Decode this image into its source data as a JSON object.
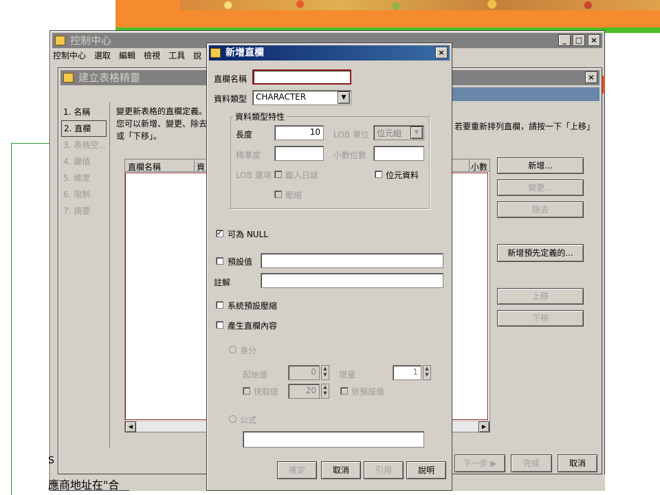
{
  "control_center": {
    "title": "控制中心",
    "menu": [
      "控制中心",
      "選取",
      "編輯",
      "檢視",
      "工具",
      "說"
    ],
    "minimize": "_",
    "maximize": "□",
    "close": "×"
  },
  "wizard": {
    "title": "建立表格精靈",
    "close": "×",
    "steps": [
      "1. 名稱",
      "2. 直欄",
      "3. 表格空...",
      "4. 鍵值",
      "5. 維度",
      "6. 限制",
      "7. 摘要"
    ],
    "description_line1": "變更新表格的直欄定義。",
    "description_line2": "您可以新增、變更、除去",
    "description_line3": "或「下移」。",
    "description_right": "若要重新排列直欄，請按一下「上移」",
    "table_headers": {
      "column_name": "直欄名稱",
      "second": "資",
      "right": "小數"
    },
    "buttons": {
      "add": "新增...",
      "change": "變更...",
      "remove": "除去",
      "add_predefined": "新增預先定義的...",
      "move_up": "上移",
      "move_down": "下移",
      "next": "下一步 ▶",
      "finish": "完成",
      "cancel": "取消"
    }
  },
  "dialog": {
    "title": "新增直欄",
    "close": "×",
    "column_name_label": "直欄名稱",
    "column_name_value": "",
    "data_type_label": "資料類型",
    "data_type_value": "CHARACTER",
    "properties_group": "資料類型特性",
    "length_label": "長度",
    "length_value": "10",
    "lob_unit_label": "LOB 單位",
    "lob_unit_value": "位元組",
    "precision_label": "精準度",
    "scale_label": "小數位數",
    "lob_options_label": "LOB 選項",
    "logged_label": "載入日誌",
    "bit_data_label": "位元資料",
    "compact_label": "壓縮",
    "nullable_label": "可為 NULL",
    "nullable_checked": "✓",
    "default_label": "預設值",
    "default_value": "",
    "comment_label": "註解",
    "comment_value": "",
    "system_compress_label": "系統預設壓縮",
    "generate_label": "產生直欄內容",
    "identity_label": "身分",
    "start_label": "起始值",
    "start_value": "0",
    "increment_label": "增量",
    "increment_value": "1",
    "cache_label": "快取值",
    "cache_value": "20",
    "default_inc_label": "依預設值",
    "formula_label": "公式",
    "formula_value": "",
    "buttons": {
      "ok": "確定",
      "cancel": "取消",
      "apply": "引用",
      "help": "說明"
    }
  },
  "slide_text": {
    "bottom_line": "應商地址在\"合",
    "bottom_line_top": "S"
  }
}
